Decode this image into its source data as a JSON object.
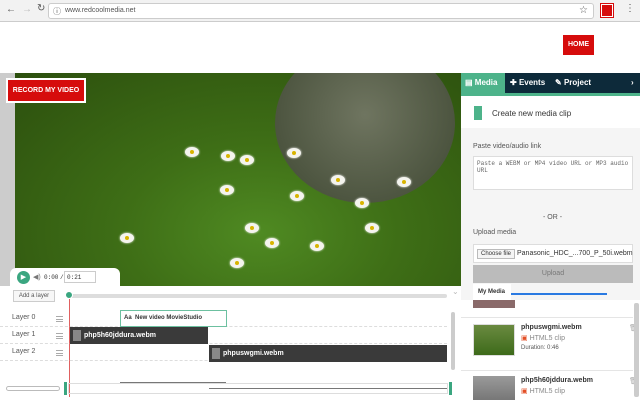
{
  "browser": {
    "url": "www.redcoolmedia.net",
    "icons": [
      "back-arrow-icon",
      "forward-arrow-icon",
      "reload-icon",
      "info-icon",
      "star-icon",
      "extension-icon",
      "menu-dots-icon"
    ]
  },
  "header": {
    "home_label": "HOME",
    "brand_color": "#d60c0c"
  },
  "video": {
    "record_label": "RECORD MY VIDEO",
    "current_time": "0:00",
    "separator": "/",
    "duration": "0:21"
  },
  "sidebar": {
    "tabs": [
      {
        "label": "Media",
        "active": true
      },
      {
        "label": "Events"
      },
      {
        "label": "Project"
      }
    ],
    "accent": "#4db38a",
    "create_label": "Create new media clip",
    "paste_label": "Paste video/audio link",
    "paste_placeholder": "Paste a WEBM or MP4 video URL or MP3 audio URL",
    "or_label": "- OR -",
    "upload_label": "Upload media",
    "choose_file": "Choose file",
    "file_name": "Panasonic_HDC_...700_P_50i.webm",
    "upload_button": "Upload",
    "my_media_tab": "My Media",
    "media": [
      {
        "name": "phpuswgmi.webm",
        "type": "HTML5 clip",
        "duration": "Duration: 0:46"
      },
      {
        "name": "php5h60jddura.webm",
        "type": "HTML5 clip"
      }
    ]
  },
  "timeline": {
    "add_layer": "Add a layer",
    "layers": [
      "Layer 0",
      "Layer 1",
      "Layer 2"
    ],
    "text_clip": {
      "icon": "Aa",
      "label": "New video MovieStudio"
    },
    "clips": [
      {
        "label": "php5h60jddura.webm"
      },
      {
        "label": "phpuswgmi.webm"
      }
    ]
  }
}
